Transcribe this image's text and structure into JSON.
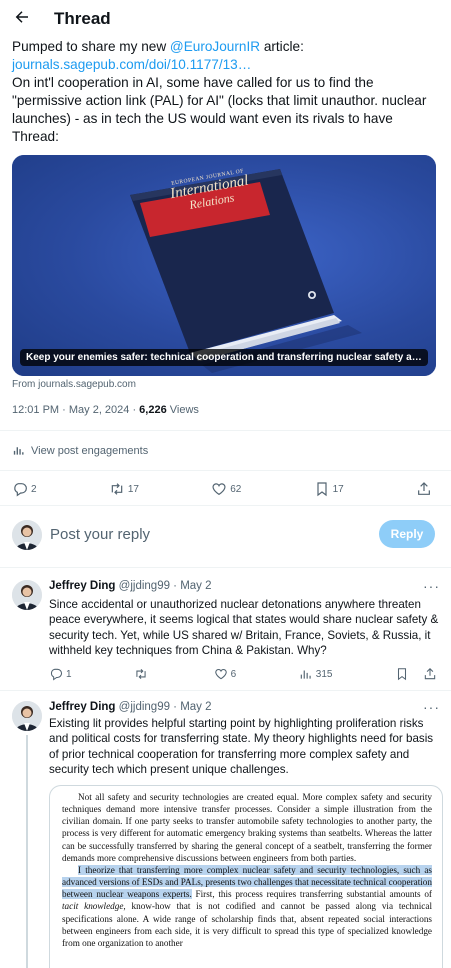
{
  "header": {
    "title": "Thread"
  },
  "tweet": {
    "line1_prefix": "Pumped to share my new ",
    "line1_mention": "@EuroJournIR",
    "line1_suffix": " article:",
    "link": "journals.sagepub.com/doi/10.1177/13…",
    "body": "On int'l cooperation in AI, some have called for us to find the \"permissive action link (PAL) for AI\" (locks that limit unauthor. nuclear launches) - as in tech the US would want even its rivals to have",
    "thread_label": "Thread:",
    "card": {
      "journal_small": "EUROPEAN JOURNAL OF",
      "journal_line1": "International",
      "journal_line2": "Relations",
      "caption": "Keep your enemies safer: technical cooperation and transferring nuclear safety and sec…"
    },
    "from": "From journals.sagepub.com",
    "time": "12:01 PM · May 2, 2024 · ",
    "views_count": "6,226",
    "views_label": " Views",
    "engagements": "View post engagements",
    "replies": "2",
    "reposts": "17",
    "likes": "62",
    "bookmarks": "17"
  },
  "compose": {
    "placeholder": "Post your reply",
    "button": "Reply"
  },
  "replies": [
    {
      "name": "Jeffrey Ding",
      "handle": "@jjding99 · May 2",
      "text": "Since accidental or unauthorized nuclear detonations anywhere threaten peace everywhere, it seems logical that states would share nuclear safety & security tech. Yet, while US shared w/ Britain, France, Soviets, & Russia, it withheld key techniques from China & Pakistan. Why?",
      "replies": "1",
      "reposts": "",
      "likes": "6",
      "views": "315"
    },
    {
      "name": "Jeffrey Ding",
      "handle": "@jjding99 · May 2",
      "text": "Existing lit provides helpful starting point by highlighting proliferation risks and political costs for transferring state. My theory highlights need for basis of prior technical cooperation for transferring more complex safety and security tech which present unique challenges."
    }
  ],
  "document": {
    "p1": "Not all safety and security technologies are created equal. More complex safety and security techniques demand more intensive transfer processes. Consider a simple illustration from the civilian domain. If one party seeks to transfer automobile safety technologies to another party, the process is very different for automatic emergency braking systems than seatbelts. Whereas the latter can be successfully transferred by sharing the general concept of a seatbelt, transferring the former demands more comprehensive discussions between engineers from both parties.",
    "p2_highlight": "I theorize that transferring more complex nuclear safety and security technologies, such as advanced versions of ESDs and PALs, presents two challenges that necessitate technical cooperation between nuclear weapons experts.",
    "p2_rest_a": " First, this process requires transferring substantial amounts of ",
    "p2_italic": "tacit knowledge",
    "p2_rest_b": ", know-how that is not codified and cannot be passed along via technical specifications alone. A wide range of scholarship finds that, absent repeated social interactions between engineers from each side, it is very difficult to spread this type of specialized knowledge from one organization to another"
  },
  "colors": {
    "accent": "#1d9bf0",
    "reply_button": "#8ecdf8",
    "card_bg": "#2c4fa8",
    "book_red": "#c8262e"
  }
}
